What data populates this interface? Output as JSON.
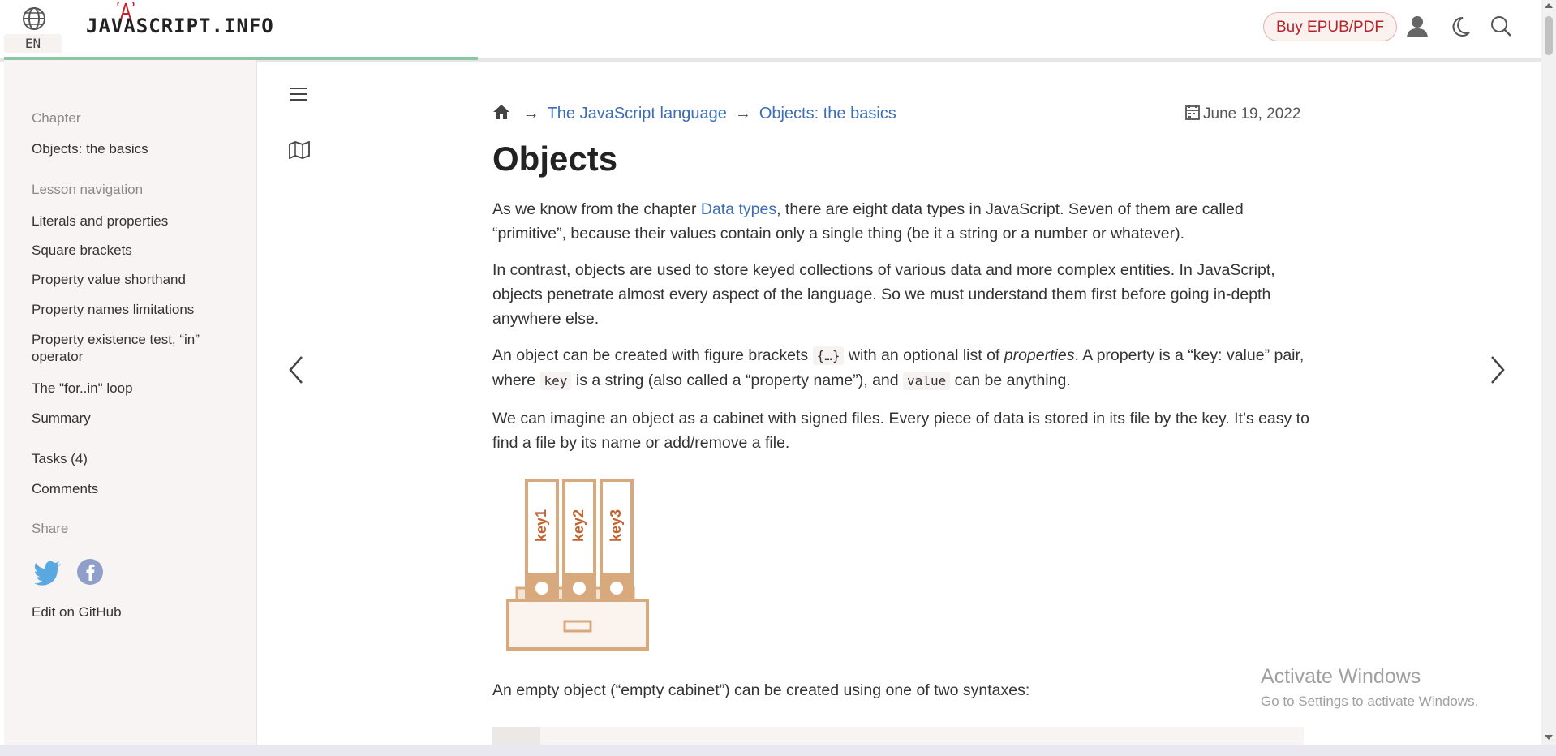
{
  "header": {
    "lang_code": "EN",
    "logo_text": "JAVASCRIPT.INFO",
    "buy_label": "Buy EPUB/PDF"
  },
  "sidebar": {
    "chapter_heading": "Chapter",
    "chapter_title": "Objects: the basics",
    "lesson_heading": "Lesson navigation",
    "lessons": [
      "Literals and properties",
      "Square brackets",
      "Property value shorthand",
      "Property names limitations",
      "Property existence test, “in”",
      "operator",
      "The \"for..in\" loop",
      "Summary"
    ],
    "tasks": "Tasks (4)",
    "comments": "Comments",
    "share_heading": "Share",
    "edit": "Edit on GitHub"
  },
  "breadcrumbs": {
    "arrow": "→",
    "level1": "The JavaScript language",
    "level2": "Objects: the basics"
  },
  "date": "June 19, 2022",
  "article": {
    "title": "Objects",
    "p1_before": "As we know from the chapter ",
    "p1_link": "Data types",
    "p1_after": ", there are eight data types in JavaScript. Seven of them are called “primitive”, because their values contain only a single thing (be it a string or a number or whatever).",
    "p2": "In contrast, objects are used to store keyed collections of various data and more complex entities. In JavaScript, objects penetrate almost every aspect of the language. So we must understand them first before going in-depth anywhere else.",
    "p3_a": "An object can be created with figure brackets ",
    "p3_code1": "{…}",
    "p3_b": " with an optional list of ",
    "p3_em": "properties",
    "p3_c": ". A property is a “key: value” pair, where ",
    "p3_code2": "key",
    "p3_d": " is a string (also called a “property name”), and ",
    "p3_code3": "value",
    "p3_e": " can be anything.",
    "p4": "We can imagine an object as a cabinet with signed files. Every piece of data is stored in its file by the key. It’s easy to find a file by its name or add/remove a file.",
    "p5": "An empty object (“empty cabinet”) can be created using one of two syntaxes:",
    "figure_labels": [
      "key1",
      "key2",
      "key3"
    ]
  },
  "watermark": {
    "line1": "Activate Windows",
    "line2": "Go to Settings to activate Windows."
  },
  "colors": {
    "link": "#3c6db5",
    "buy_text": "#b5262b",
    "progress": "#8ac7a5",
    "figure": "#d9a97e"
  }
}
